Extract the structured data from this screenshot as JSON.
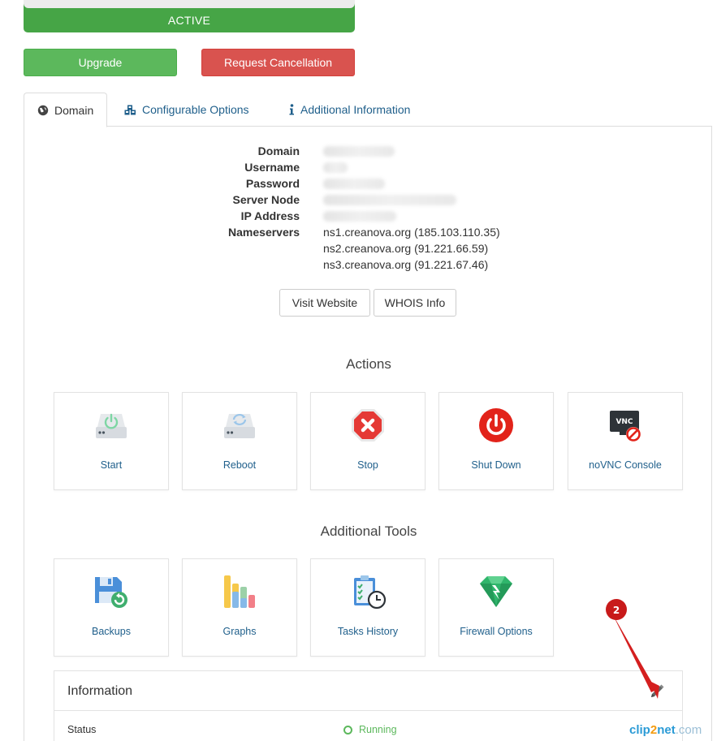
{
  "status": {
    "label": "ACTIVE"
  },
  "buttons": {
    "upgrade": "Upgrade",
    "cancel": "Request Cancellation"
  },
  "tabs": [
    {
      "label": "Domain",
      "icon": "globe-icon"
    },
    {
      "label": "Configurable Options",
      "icon": "cubes-icon"
    },
    {
      "label": "Additional Information",
      "icon": "info-icon"
    }
  ],
  "details": {
    "labels": {
      "domain": "Domain",
      "username": "Username",
      "password": "Password",
      "server_node": "Server Node",
      "ip_address": "IP Address",
      "nameservers": "Nameservers"
    },
    "nameservers": [
      "ns1.creanova.org (185.103.110.35)",
      "ns2.creanova.org (91.221.66.59)",
      "ns3.creanova.org (91.221.67.46)"
    ]
  },
  "links": {
    "visit_website": "Visit Website",
    "whois": "WHOIS Info"
  },
  "actions": {
    "title": "Actions",
    "items": [
      {
        "label": "Start",
        "icon": "power-on-server-icon"
      },
      {
        "label": "Reboot",
        "icon": "reboot-server-icon"
      },
      {
        "label": "Stop",
        "icon": "stop-icon"
      },
      {
        "label": "Shut Down",
        "icon": "shutdown-icon"
      },
      {
        "label": "noVNC Console",
        "icon": "vnc-console-icon"
      }
    ]
  },
  "tools": {
    "title": "Additional Tools",
    "items": [
      {
        "label": "Backups",
        "icon": "backup-disk-icon"
      },
      {
        "label": "Graphs",
        "icon": "graphs-icon"
      },
      {
        "label": "Tasks History",
        "icon": "tasks-history-icon"
      },
      {
        "label": "Firewall Options",
        "icon": "firewall-icon"
      }
    ]
  },
  "information": {
    "title": "Information",
    "status_label": "Status",
    "status_value": "Running"
  },
  "annotation": {
    "number": "2"
  },
  "watermark": {
    "part1": "clip",
    "part2": "2",
    "part3": "net",
    "part4": ".com"
  },
  "colors": {
    "active": "#46a546",
    "danger": "#d9534f",
    "link": "#1f5f8b",
    "running": "#5cb85c"
  }
}
